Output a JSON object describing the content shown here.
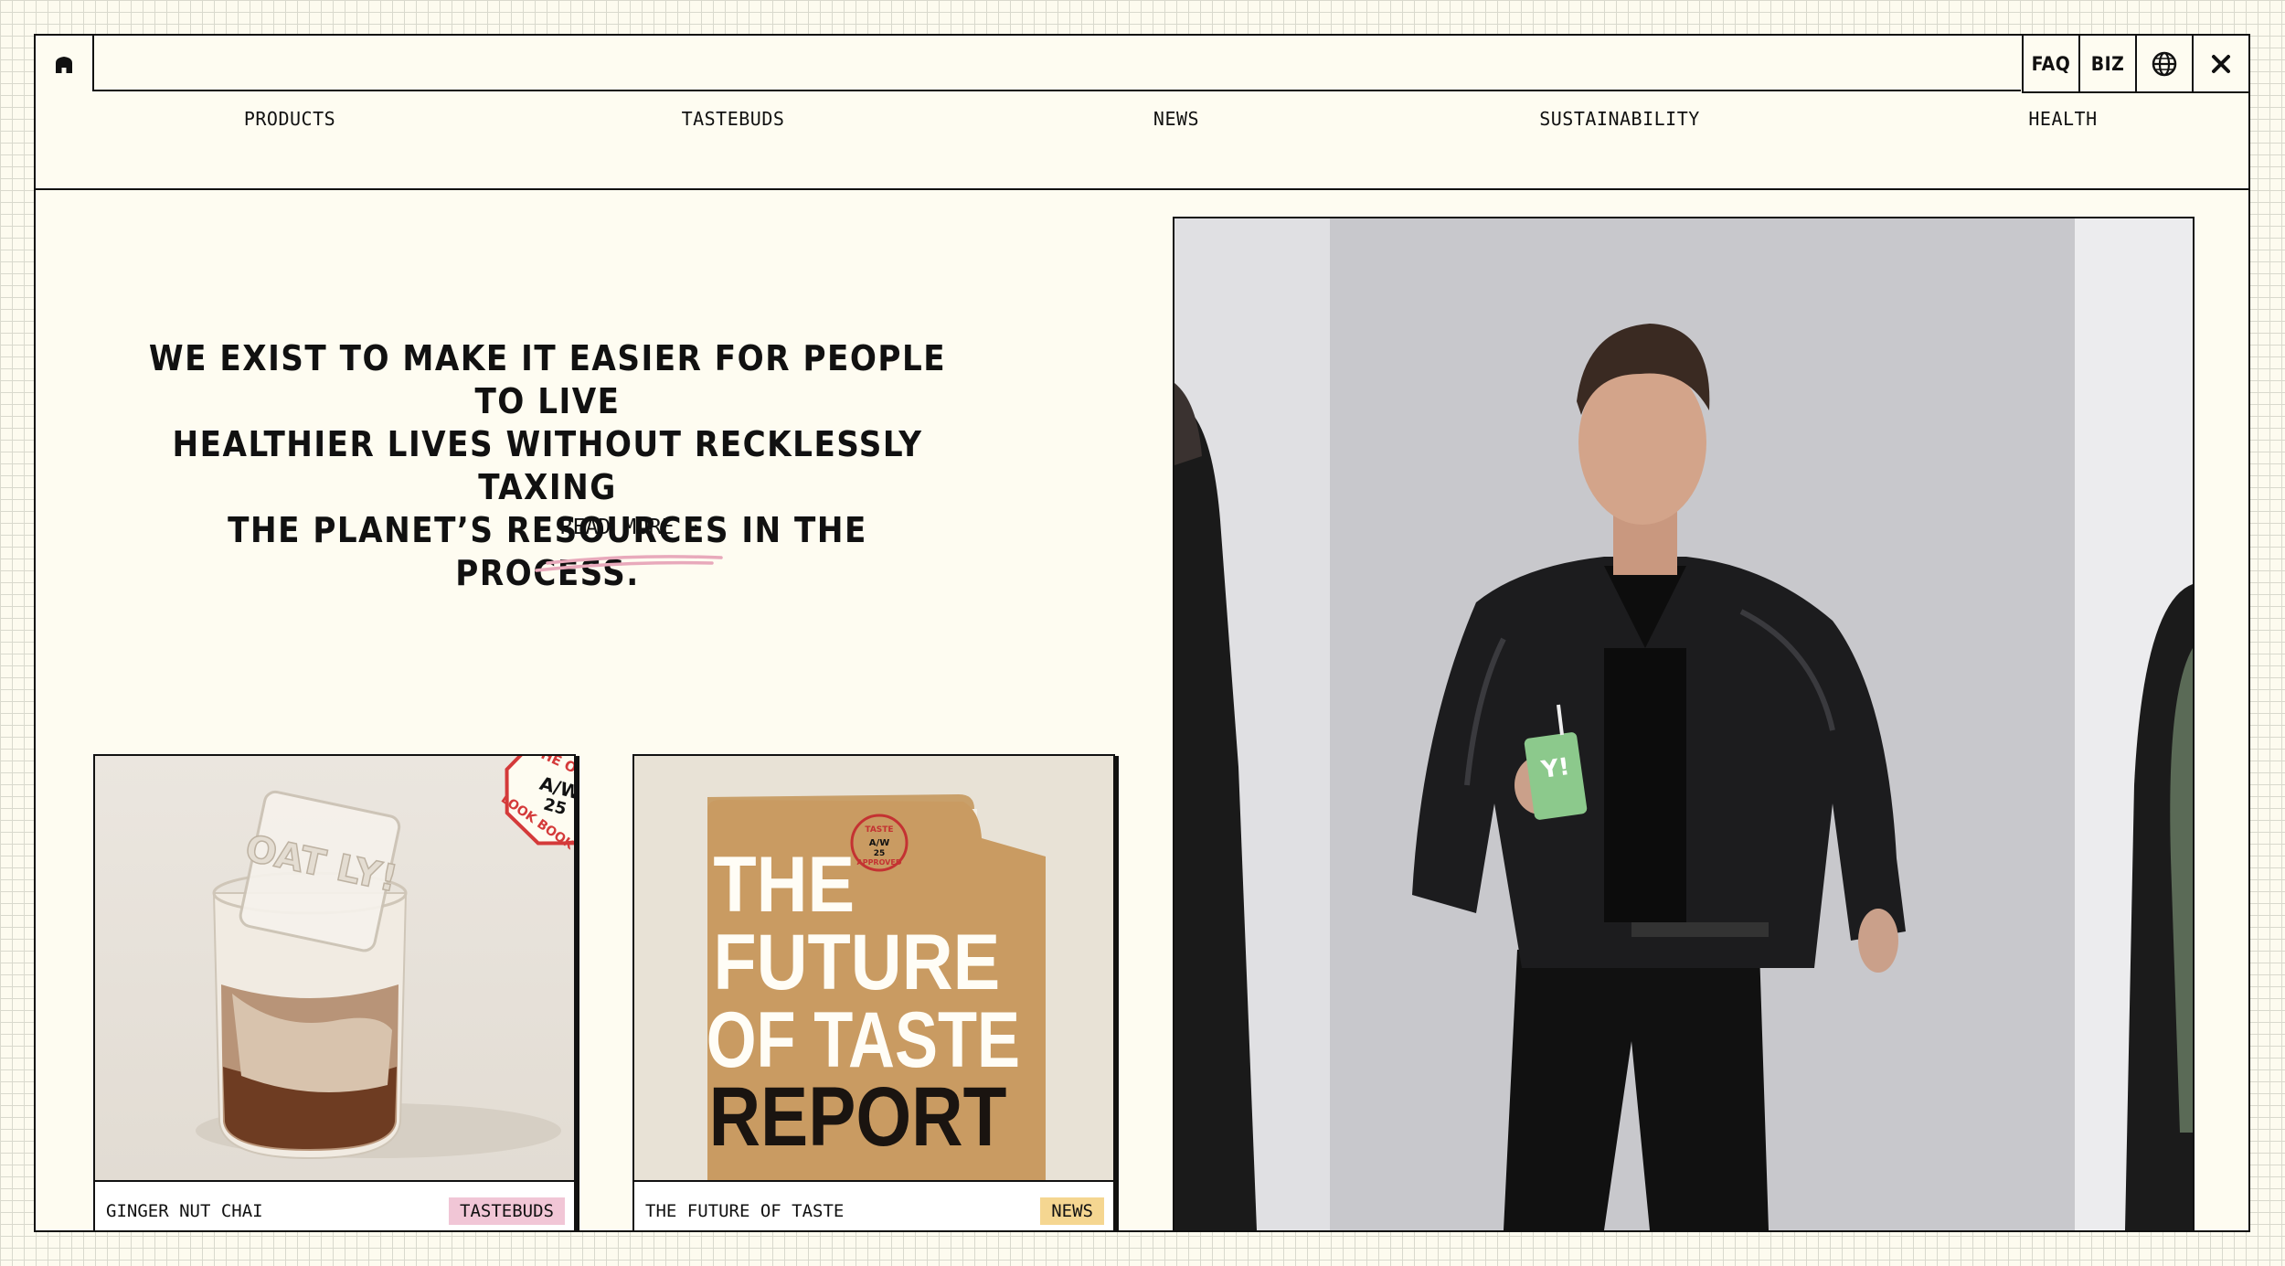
{
  "topbar": {
    "faq": "FAQ",
    "biz": "BIZ"
  },
  "nav": [
    "PRODUCTS",
    "TASTEBUDS",
    "NEWS",
    "SUSTAINABILITY",
    "HEALTH"
  ],
  "hero": {
    "line1": "WE EXIST TO MAKE IT EASIER FOR PEOPLE TO LIVE",
    "line2": "HEALTHIER LIVES WITHOUT RECKLESSLY TAXING",
    "line3": "THE PLANET’S RESOURCES IN THE PROCESS.",
    "read_more": "READ MORE →"
  },
  "cards": [
    {
      "caption": "GINGER NUT CHAI",
      "badge": "TASTEBUDS",
      "badge_color": "#f1c6d6",
      "stamp": {
        "top": "THE OATLY",
        "middle": "A/W",
        "year": "25",
        "bottom": "LOOK BOOK"
      },
      "ice_text": "OAT LY!"
    },
    {
      "caption": "THE FUTURE OF TASTE",
      "badge": "NEWS",
      "badge_color": "#f5d691",
      "cover": {
        "line1": "THE",
        "line2": "FUTURE",
        "line3": "OF TASTE",
        "line4": "REPORT"
      },
      "stamp": {
        "top": "TASTE",
        "middle": "A/W",
        "year": "25",
        "bottom": "APPROVED"
      }
    }
  ],
  "photo": {
    "carton_text": "Y!"
  },
  "colors": {
    "background": "#fdfbef",
    "ink": "#111111",
    "stamp_red": "#d43a3a",
    "underline_pink": "#e8a9bb"
  }
}
